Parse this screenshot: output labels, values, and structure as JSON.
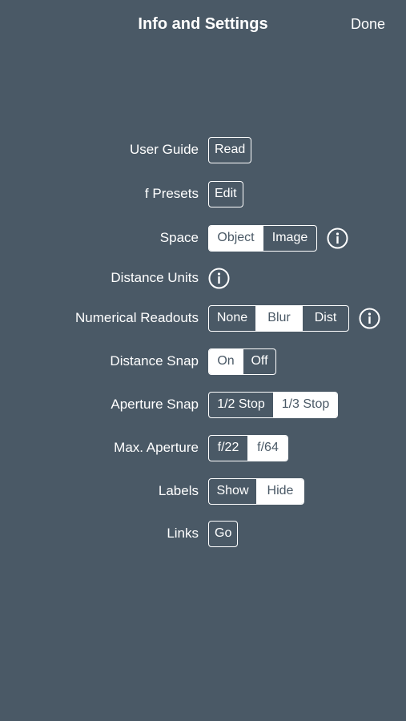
{
  "header": {
    "title": "Info and Settings",
    "done_label": "Done"
  },
  "rows": {
    "user_guide": {
      "label": "User Guide",
      "button": "Read"
    },
    "f_presets": {
      "label": "f Presets",
      "button": "Edit"
    },
    "space": {
      "label": "Space",
      "options": [
        "Object",
        "Image"
      ],
      "selected": "Object",
      "info_icon": "info-icon"
    },
    "distance_units": {
      "label": "Distance Units",
      "info_icon": "info-icon"
    },
    "numerical_readouts": {
      "label": "Numerical Readouts",
      "options": [
        "None",
        "Blur",
        "Dist"
      ],
      "selected": "Blur",
      "info_icon": "info-icon"
    },
    "distance_snap": {
      "label": "Distance Snap",
      "options": [
        "On",
        "Off"
      ],
      "selected": "On"
    },
    "aperture_snap": {
      "label": "Aperture Snap",
      "options": [
        "1/2 Stop",
        "1/3 Stop"
      ],
      "selected": "1/3 Stop"
    },
    "max_aperture": {
      "label": "Max. Aperture",
      "options": [
        "f/22",
        "f/64"
      ],
      "selected": "f/64"
    },
    "labels": {
      "label": "Labels",
      "options": [
        "Show",
        "Hide"
      ],
      "selected": "Hide"
    },
    "links": {
      "label": "Links",
      "button": "Go"
    }
  },
  "colors": {
    "background": "#4a5966",
    "foreground": "#ffffff"
  }
}
